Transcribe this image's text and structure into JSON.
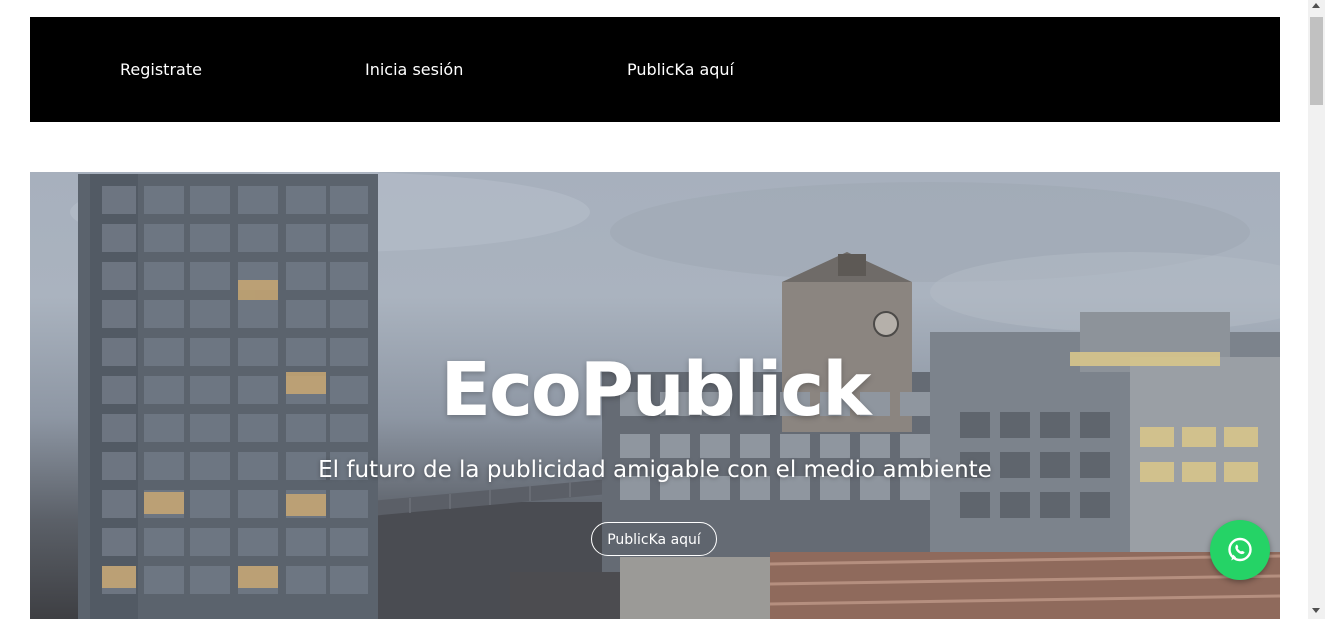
{
  "nav": {
    "items": [
      {
        "label": "Registrate"
      },
      {
        "label": "Inicia sesión"
      },
      {
        "label": "PublicKa aquí"
      }
    ]
  },
  "hero": {
    "title": "EcoPublick",
    "subtitle": "El futuro de la publicidad amigable con el medio ambiente",
    "cta_label": "PublicKa aquí",
    "background_image": "city-buildings-overcast-photo"
  },
  "floating": {
    "whatsapp_icon": "whatsapp-icon",
    "color": "#25d366"
  },
  "colors": {
    "nav_background": "#000000",
    "nav_text": "#ffffff",
    "hero_text": "#ffffff"
  }
}
